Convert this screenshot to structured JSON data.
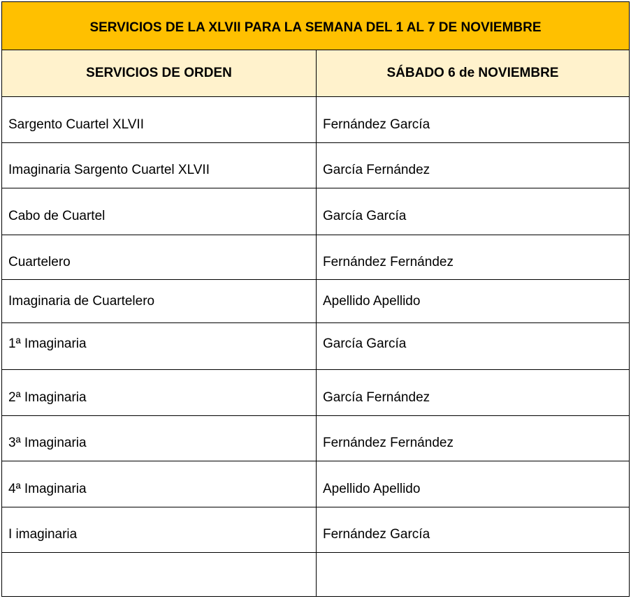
{
  "title": "SERVICIOS DE LA XLVII PARA LA SEMANA DEL 1 AL 7 DE NOVIEMBRE",
  "columns": {
    "service": "SERVICIOS DE ORDEN",
    "day": "SÁBADO 6 de NOVIEMBRE"
  },
  "rows": [
    {
      "service": "Sargento Cuartel XLVII",
      "person": "Fernández García"
    },
    {
      "service": "Imaginaria Sargento Cuartel XLVII",
      "person": "García Fernández"
    },
    {
      "service": "Cabo de Cuartel",
      "person": "García García"
    },
    {
      "service": "Cuartelero",
      "person": "Fernández Fernández"
    },
    {
      "service": "Imaginaria de Cuartelero",
      "person": "Apellido Apellido"
    },
    {
      "service": "1ª Imaginaria",
      "person": "García García"
    },
    {
      "service": "2ª Imaginaria",
      "person": "García Fernández"
    },
    {
      "service": "3ª Imaginaria",
      "person": "Fernández Fernández"
    },
    {
      "service": "4ª Imaginaria",
      "person": "Apellido Apellido"
    },
    {
      "service": "I imaginaria",
      "person": "Fernández García"
    },
    {
      "service": "",
      "person": ""
    }
  ],
  "colors": {
    "title_background": "#ffc000",
    "header_background": "#fff2cc"
  }
}
